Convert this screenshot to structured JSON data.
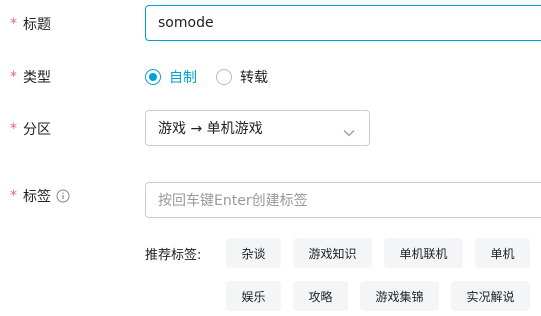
{
  "form": {
    "title": {
      "label": "标题",
      "value": "somode"
    },
    "type": {
      "label": "类型",
      "options": [
        {
          "label": "自制",
          "checked": true
        },
        {
          "label": "转载",
          "checked": false
        }
      ]
    },
    "category": {
      "label": "分区",
      "value": "游戏 → 单机游戏"
    },
    "tags": {
      "label": "标签",
      "placeholder": "按回车键Enter创建标签",
      "recommend_label": "推荐标签:",
      "recommended": [
        "杂谈",
        "游戏知识",
        "单机联机",
        "单机",
        "娱乐",
        "攻略",
        "游戏集锦",
        "实况解说"
      ]
    },
    "required_mark": "*"
  },
  "colors": {
    "accent": "#00a1d6",
    "required": "#f25d8e",
    "tag_bg": "#f4f5f7",
    "placeholder": "#999999"
  },
  "icons": {
    "tag_info": "info-circle-icon",
    "select_caret": "chevron-down-icon"
  }
}
